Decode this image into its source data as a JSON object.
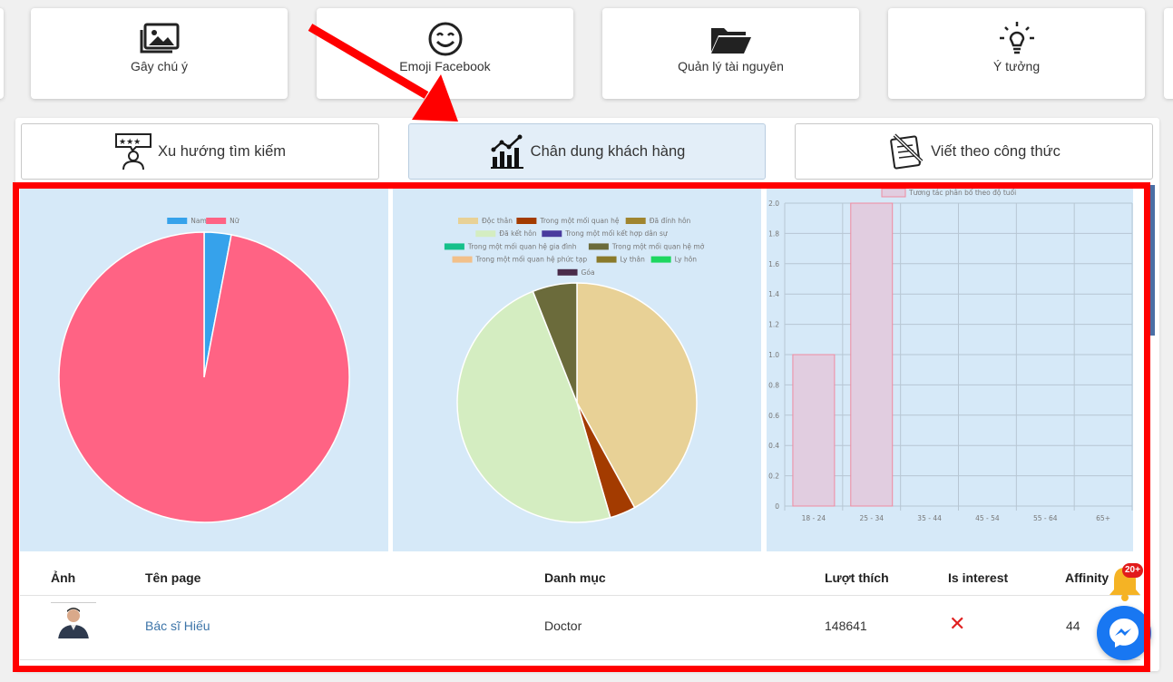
{
  "tools": [
    {
      "label": "Gây chú ý",
      "icon": "images-icon"
    },
    {
      "label": "Emoji Facebook",
      "icon": "smile-icon"
    },
    {
      "label": "Quản lý tài nguyên",
      "icon": "folder-icon"
    },
    {
      "label": "Ý tưởng",
      "icon": "lightbulb-icon"
    }
  ],
  "tabs": [
    {
      "label": "Xu hướng tìm kiếm",
      "icon": "rating-person-icon",
      "active": false
    },
    {
      "label": "Chân dung khách hàng",
      "icon": "analytics-chart-icon",
      "active": true
    },
    {
      "label": "Viết theo công thức",
      "icon": "notepad-pen-icon",
      "active": false
    }
  ],
  "chart_data": [
    {
      "type": "pie",
      "legend": [
        "Nam",
        "Nữ"
      ],
      "values": [
        3,
        97
      ],
      "colors": [
        "#36a2eb",
        "#ff6384"
      ]
    },
    {
      "type": "pie",
      "legend": [
        "Độc thân",
        "Trong một mối quan hệ",
        "Đã đính hôn",
        "Đã kết hôn",
        "Trong một mối kết hợp dân sự",
        "Trong một mối quan hệ gia đình",
        "Trong một mối quan hệ mở",
        "Trong một mối quan hệ phức tạp",
        "Ly thân",
        "Ly hôn",
        "Góa"
      ],
      "legend_colors": [
        "#e8d196",
        "#a33b00",
        "#a0852f",
        "#d4edc1",
        "#4a3b9e",
        "#16c08a",
        "#6b6b3b",
        "#f2c08a",
        "#8a7a2a",
        "#1ed760",
        "#4a2c4a"
      ],
      "slices": [
        {
          "label": "Độc thân",
          "value": 42,
          "color": "#e8d196"
        },
        {
          "label": "Trong một mối quan hệ",
          "value": 3.5,
          "color": "#a33b00"
        },
        {
          "label": "Đã kết hôn",
          "value": 48.5,
          "color": "#d4edc1"
        },
        {
          "label": "Trong một mối quan hệ mở",
          "value": 6,
          "color": "#6b6b3b"
        }
      ]
    },
    {
      "type": "bar",
      "legend": [
        "Tương tác phân bố theo độ tuổi"
      ],
      "categories": [
        "18 - 24",
        "25 - 34",
        "35 - 44",
        "45 - 54",
        "55 - 64",
        "65+"
      ],
      "values": [
        1,
        2,
        0,
        0,
        0,
        0
      ],
      "ylim": [
        0,
        2
      ],
      "yticks": [
        "0",
        "0.2",
        "0.4",
        "0.6",
        "0.8",
        "1.0",
        "1.2",
        "1.4",
        "1.6",
        "1.8",
        "2.0"
      ],
      "grid": true,
      "bar_color": "#e1cde0",
      "bar_border": "#f08aa0"
    }
  ],
  "table": {
    "headers": {
      "avatar": "Ảnh",
      "page": "Tên page",
      "category": "Danh mục",
      "likes": "Lượt thích",
      "interest": "Is interest",
      "affinity": "Affinity"
    },
    "rows": [
      {
        "page": "Bác sĩ Hiếu",
        "category": "Doctor",
        "likes": "148641",
        "interest": "✕",
        "affinity": "44"
      }
    ]
  },
  "notification": {
    "count": "20+"
  },
  "colors": {
    "accent_red": "#ff0000",
    "link": "#3c74a8",
    "messenger": "#1877f2"
  }
}
